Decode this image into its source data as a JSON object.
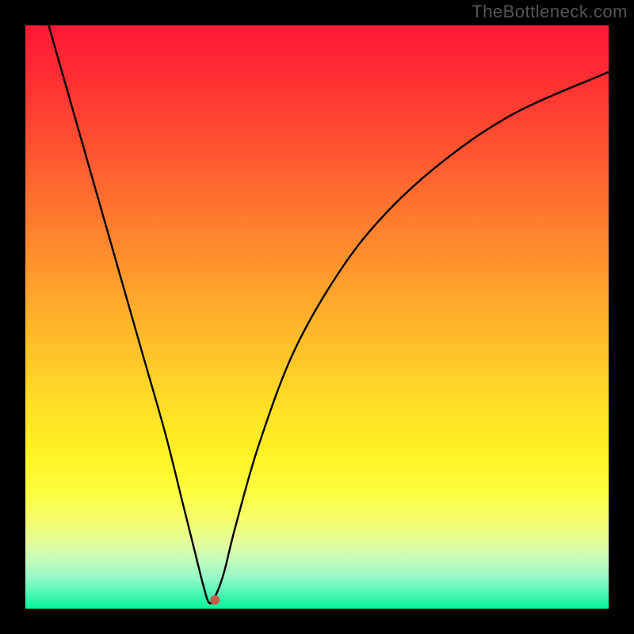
{
  "watermark": "TheBottleneck.com",
  "chart_data": {
    "type": "line",
    "title": "",
    "xlabel": "",
    "ylabel": "",
    "xlim": [
      0,
      100
    ],
    "ylim": [
      0,
      100
    ],
    "grid": false,
    "legend": false,
    "series": [
      {
        "name": "curve",
        "x": [
          4,
          8,
          12,
          16,
          20,
          24,
          27,
          29,
          30.5,
          31.5,
          32.5,
          34,
          36,
          40,
          46,
          54,
          62,
          72,
          84,
          100
        ],
        "y": [
          100,
          86,
          72,
          58,
          44,
          30,
          18,
          10,
          4,
          1,
          2,
          6,
          14,
          28,
          44,
          58,
          68,
          77,
          85,
          92
        ]
      }
    ],
    "marker": {
      "x": 32.5,
      "y": 1.5
    },
    "background_gradient": {
      "top": "#ff1a34",
      "bottom": "#08f49a"
    }
  }
}
